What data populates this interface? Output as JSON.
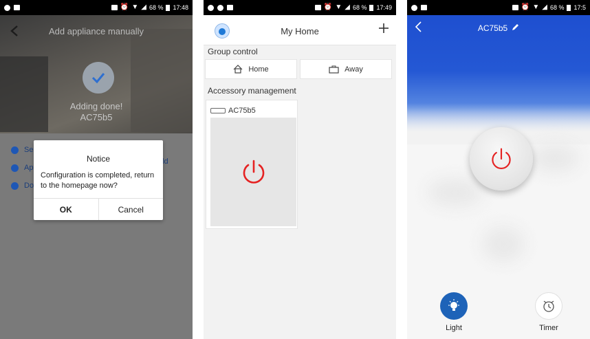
{
  "colors": {
    "accent_blue": "#1e57b5",
    "power_red": "#e52222",
    "sky_blue": "#2458d4"
  },
  "screen1": {
    "status": {
      "battery": "68 %",
      "time": "17:48"
    },
    "title": "Add appliance manually",
    "back_icon": "chevron-left-icon",
    "adding_done": "Adding done!",
    "device_name": "AC75b5",
    "steps": [
      "Se",
      "Ap",
      "Do"
    ],
    "step_tail": "ld",
    "dialog": {
      "title": "Notice",
      "message": "Configuration is completed, return to the homepage now?",
      "ok": "OK",
      "cancel": "Cancel"
    }
  },
  "screen2": {
    "status": {
      "battery": "68 %",
      "time": "17:49"
    },
    "title": "My Home",
    "group_control": "Group control",
    "home_btn": "Home",
    "away_btn": "Away",
    "accessory_management": "Accessory management",
    "device_card": "AC75b5"
  },
  "screen3": {
    "status": {
      "battery": "68 %",
      "time": "17:5"
    },
    "device_title": "AC75b5",
    "light": "Light",
    "timer": "Timer"
  }
}
